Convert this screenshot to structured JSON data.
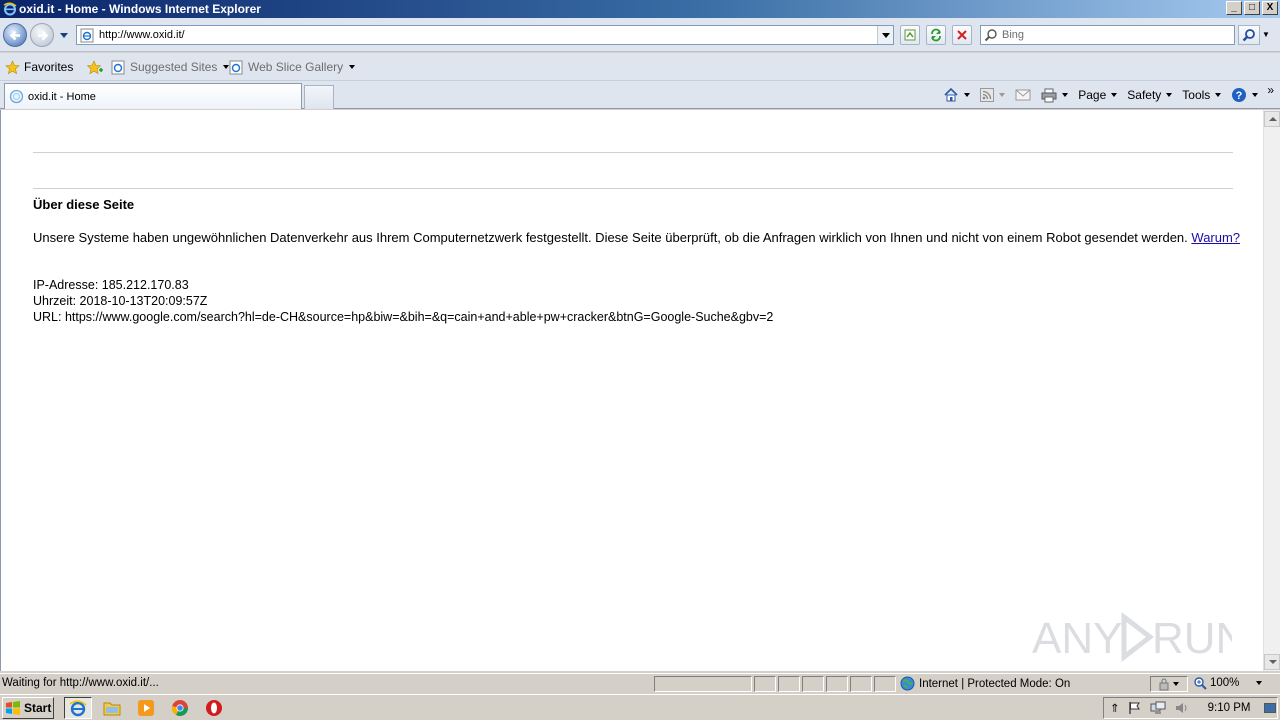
{
  "window": {
    "title": "oxid.it - Home - Windows Internet Explorer",
    "controls": [
      "_",
      "□",
      "X"
    ]
  },
  "navbar": {
    "address": "http://www.oxid.it/",
    "search_placeholder": "Bing"
  },
  "favorites_bar": {
    "favorites_label": "Favorites",
    "items": [
      {
        "label": "Suggested Sites"
      },
      {
        "label": "Web Slice Gallery"
      }
    ]
  },
  "tabs": {
    "active_tab": "oxid.it - Home"
  },
  "command_bar": {
    "page": "Page",
    "safety": "Safety",
    "tools": "Tools",
    "more": "»"
  },
  "page": {
    "heading": "Über diese Seite",
    "paragraph": "Unsere Systeme haben ungewöhnlichen Datenverkehr aus Ihrem Computernetzwerk festgestellt. Diese Seite überprüft, ob die Anfragen wirklich von Ihnen und nicht von einem Robot gesendet werden.",
    "link": "Warum?",
    "ip_line": "IP-Adresse: 185.212.170.83",
    "time_line": "Uhrzeit: 2018-10-13T20:09:57Z",
    "url_line": "URL: https://www.google.com/search?hl=de-CH&source=hp&biw=&bih=&q=cain+and+able+pw+cracker&btnG=Google-Suche&gbv=2",
    "watermark": "ANY RUN"
  },
  "statusbar": {
    "status": "Waiting for http://www.oxid.it/...",
    "zone": "Internet | Protected Mode: On",
    "zoom": "100%"
  },
  "taskbar": {
    "start": "Start",
    "clock": "9:10 PM"
  }
}
